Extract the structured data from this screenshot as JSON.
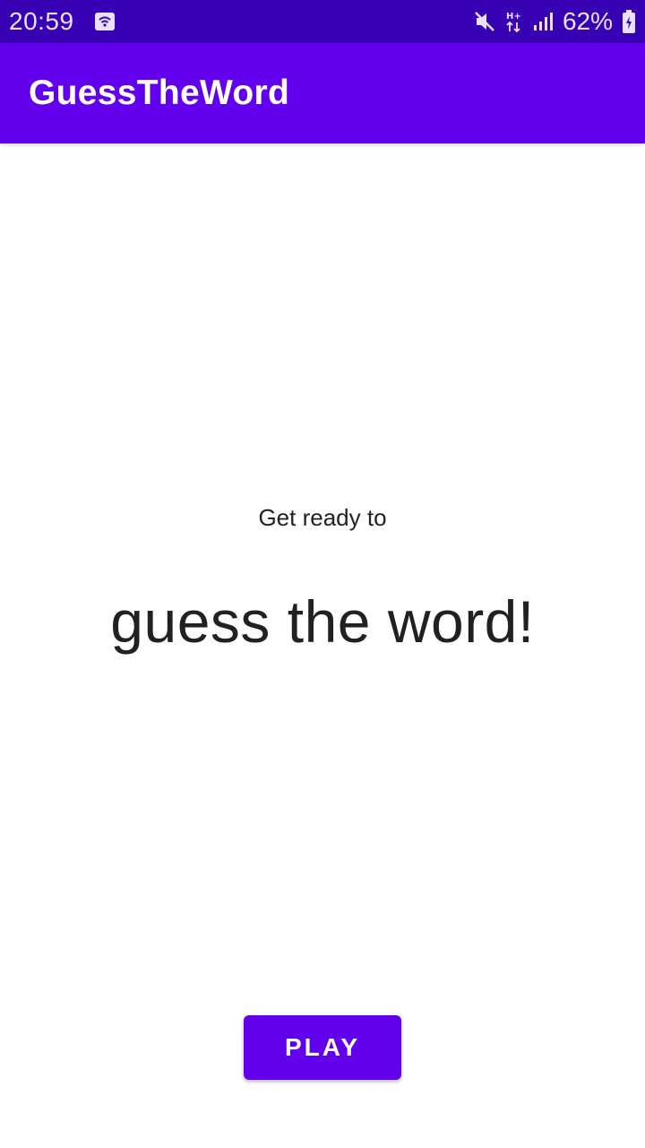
{
  "status_bar": {
    "time": "20:59",
    "battery_percent": "62%",
    "icons": [
      "screen-cast-icon",
      "mute-icon",
      "network-hplus-icon",
      "signal-icon",
      "battery-icon"
    ]
  },
  "app_bar": {
    "title": "GuessTheWord"
  },
  "main": {
    "intro": "Get ready to",
    "title": "guess the word!",
    "play_label": "PLAY"
  },
  "colors": {
    "status_bar": "#3700b3",
    "primary": "#6200ee",
    "text": "#212121",
    "background": "#ffffff"
  }
}
